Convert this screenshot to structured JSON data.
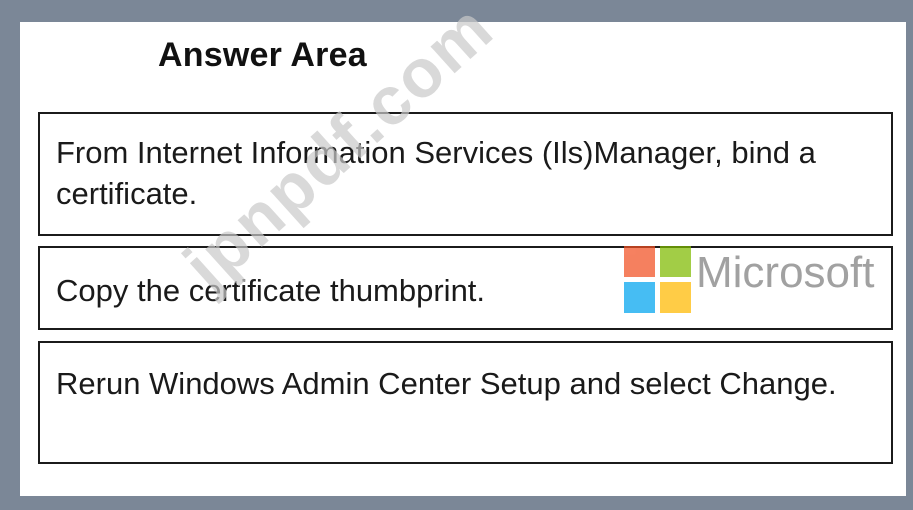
{
  "title": "Answer Area",
  "answers": [
    "From Internet Information Services (Ils)Manager, bind a certificate.",
    "Copy the certificate thumbprint.",
    "Rerun Windows Admin Center Setup and select Change."
  ],
  "overlay": {
    "logo_text": "Microsoft",
    "logo_colors": [
      "#f25022",
      "#7fba00",
      "#00a4ef",
      "#ffb900"
    ],
    "watermark": "jpnpdf.com"
  }
}
